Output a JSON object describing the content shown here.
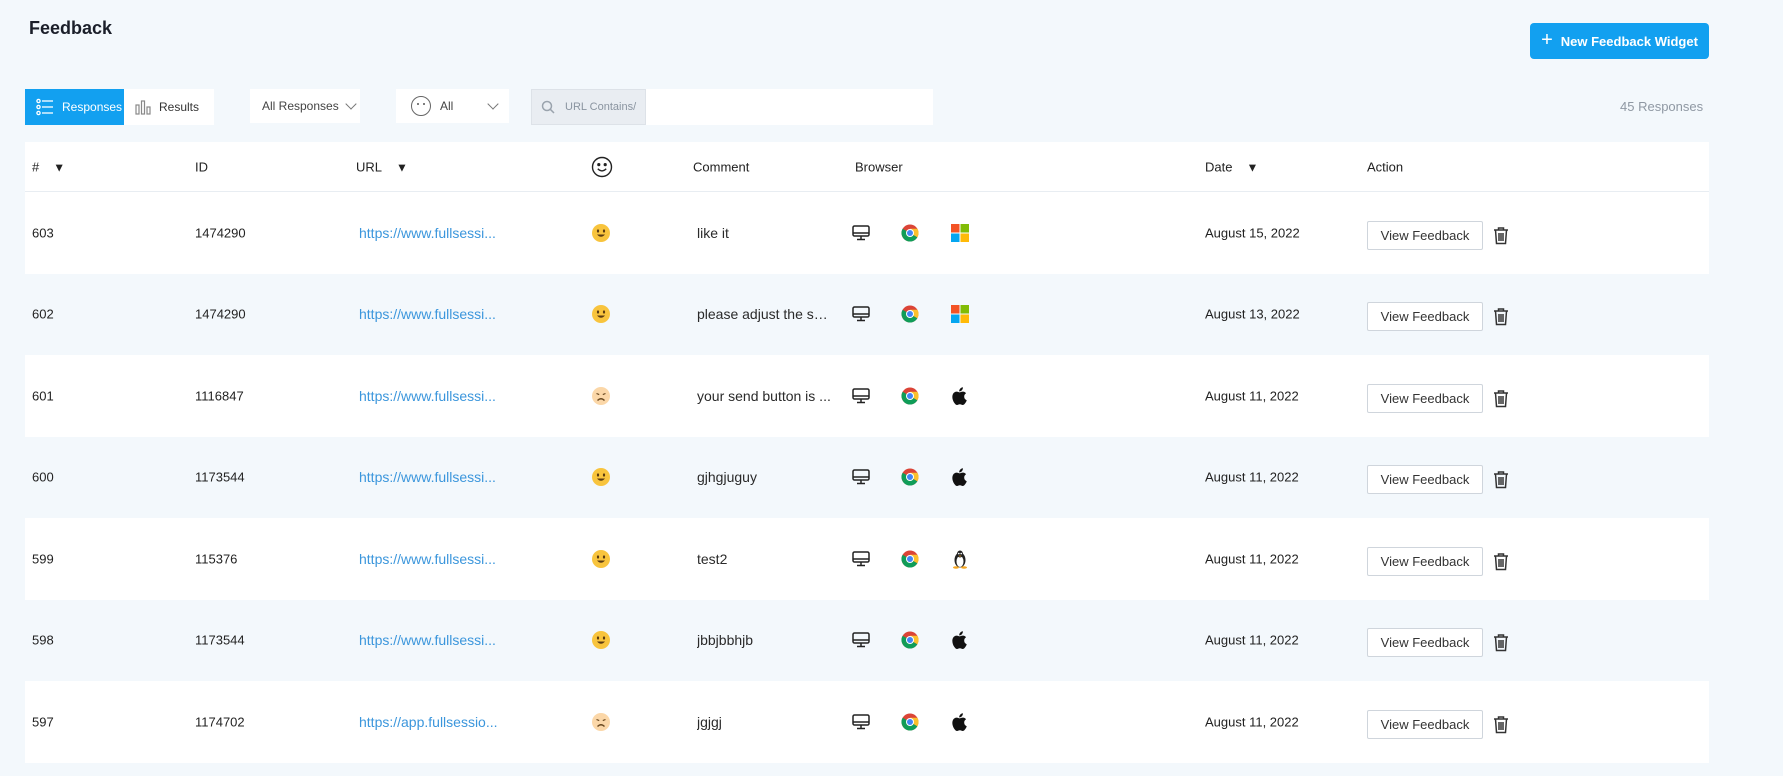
{
  "header": {
    "title": "Feedback",
    "new_widget_label": "New Feedback Widget"
  },
  "toolbar": {
    "responses_tab": "Responses",
    "results_tab": "Results",
    "filter_responses": "All Responses",
    "filter_sentiment": "All",
    "search_prefix": "URL Contains/",
    "search_value": "",
    "response_count": "45 Responses"
  },
  "table": {
    "columns": {
      "num": "#",
      "id": "ID",
      "url": "URL",
      "comment": "Comment",
      "browser": "Browser",
      "date": "Date",
      "action": "Action"
    },
    "view_label": "View Feedback",
    "rows": [
      {
        "num": "603",
        "id": "1474290",
        "url": "https://www.fullsessi...",
        "sentiment": "happy",
        "comment": "like it",
        "device": "desktop",
        "browser": "chrome",
        "os": "windows",
        "date": "August 15, 2022"
      },
      {
        "num": "602",
        "id": "1474290",
        "url": "https://www.fullsessi...",
        "sentiment": "happy",
        "comment": "please adjust the se...",
        "device": "desktop",
        "browser": "chrome",
        "os": "windows",
        "date": "August 13, 2022"
      },
      {
        "num": "601",
        "id": "1116847",
        "url": "https://www.fullsessi...",
        "sentiment": "sad",
        "comment": "your send button is ...",
        "device": "desktop",
        "browser": "chrome",
        "os": "apple",
        "date": "August 11, 2022"
      },
      {
        "num": "600",
        "id": "1173544",
        "url": "https://www.fullsessi...",
        "sentiment": "happy",
        "comment": "gjhgjuguy",
        "device": "desktop",
        "browser": "chrome",
        "os": "apple",
        "date": "August 11, 2022"
      },
      {
        "num": "599",
        "id": "115376",
        "url": "https://www.fullsessi...",
        "sentiment": "happy",
        "comment": "test2",
        "device": "desktop",
        "browser": "chrome",
        "os": "linux",
        "date": "August 11, 2022"
      },
      {
        "num": "598",
        "id": "1173544",
        "url": "https://www.fullsessi...",
        "sentiment": "happy",
        "comment": "jbbjbbhjb",
        "device": "desktop",
        "browser": "chrome",
        "os": "apple",
        "date": "August 11, 2022"
      },
      {
        "num": "597",
        "id": "1174702",
        "url": "https://app.fullsessio...",
        "sentiment": "sad",
        "comment": "jgjgj",
        "device": "desktop",
        "browser": "chrome",
        "os": "apple",
        "date": "August 11, 2022"
      }
    ]
  },
  "colors": {
    "accent": "#12a0f0",
    "link": "#3b96dc",
    "background": "#f3f8fc"
  }
}
